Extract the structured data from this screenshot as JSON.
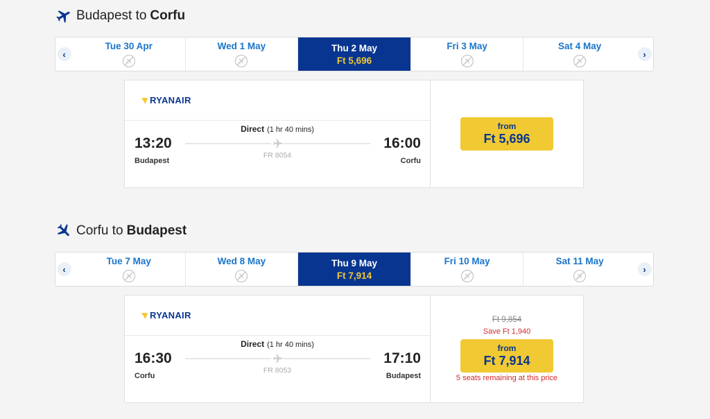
{
  "outbound": {
    "title_from": "Budapest to",
    "title_to": "Corfu",
    "days": [
      {
        "label": "Tue 30 Apr",
        "price": "",
        "selected": false
      },
      {
        "label": "Wed 1 May",
        "price": "",
        "selected": false
      },
      {
        "label": "Thu 2 May",
        "price": "Ft 5,696",
        "selected": true
      },
      {
        "label": "Fri 3 May",
        "price": "",
        "selected": false
      },
      {
        "label": "Sat 4 May",
        "price": "",
        "selected": false
      }
    ],
    "airline": "RYANAIR",
    "direct": "Direct",
    "duration": "(1 hr 40 mins)",
    "flight_number": "FR 8054",
    "dep_time": "13:20",
    "dep_city": "Budapest",
    "arr_time": "16:00",
    "arr_city": "Corfu",
    "price_from": "from",
    "price": "Ft 5,696"
  },
  "inbound": {
    "title_from": "Corfu to",
    "title_to": "Budapest",
    "days": [
      {
        "label": "Tue 7 May",
        "price": "",
        "selected": false
      },
      {
        "label": "Wed 8 May",
        "price": "",
        "selected": false
      },
      {
        "label": "Thu 9 May",
        "price": "Ft 7,914",
        "selected": true
      },
      {
        "label": "Fri 10 May",
        "price": "",
        "selected": false
      },
      {
        "label": "Sat 11 May",
        "price": "",
        "selected": false
      }
    ],
    "airline": "RYANAIR",
    "direct": "Direct",
    "duration": "(1 hr 40 mins)",
    "flight_number": "FR 8053",
    "dep_time": "16:30",
    "dep_city": "Corfu",
    "arr_time": "17:10",
    "arr_city": "Budapest",
    "old_price": "Ft 9,854",
    "save_text": "Save  Ft 1,940",
    "price_from": "from",
    "price": "Ft 7,914",
    "seats_text": "5 seats remaining at this price"
  },
  "icons": {
    "plane": "plane-icon",
    "no_flight": "no-flight-icon",
    "prev": "‹",
    "next": "›"
  },
  "colors": {
    "brand_blue": "#073590",
    "accent_yellow": "#f1c933",
    "link_blue": "#1a75c9",
    "alert_red": "#d22b2b"
  }
}
